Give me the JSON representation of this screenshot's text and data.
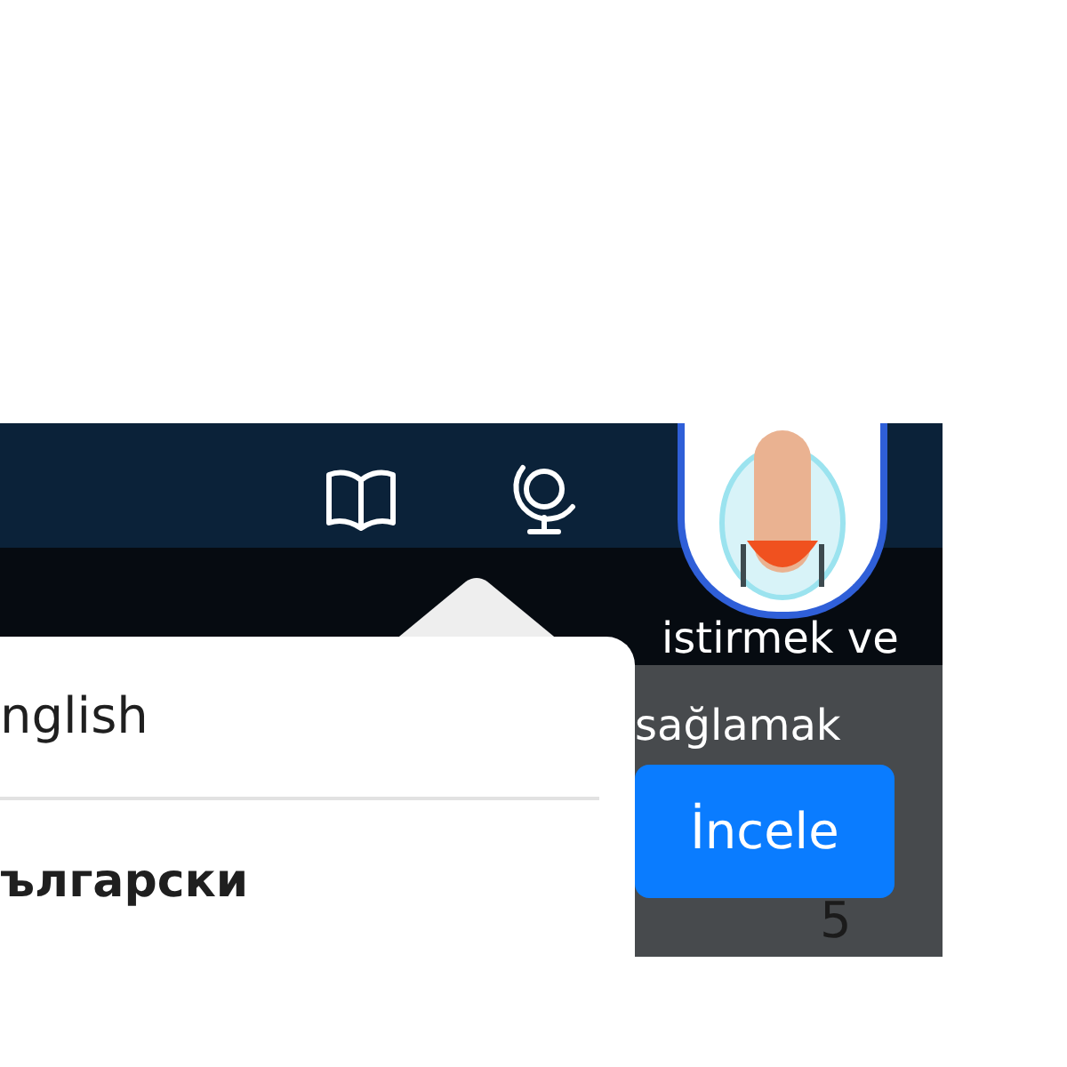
{
  "banner": {
    "text": "istirmek ve"
  },
  "card": {
    "text": "sağlamak",
    "button": "İncele",
    "count": "5"
  },
  "language_menu": {
    "items": [
      {
        "label": "nglish"
      },
      {
        "label": "ългарски"
      }
    ]
  }
}
